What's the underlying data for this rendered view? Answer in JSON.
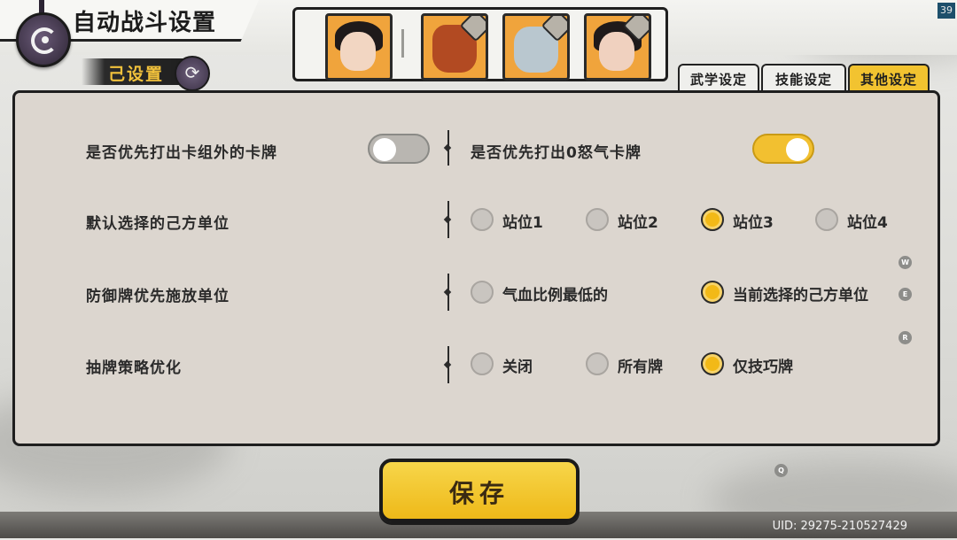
{
  "header": {
    "title": "自动战斗设置",
    "fps": "39"
  },
  "preset": {
    "label": "己设置"
  },
  "heroes": [
    {
      "name": "hero-1",
      "skin": "#f2d6c2",
      "bg": "#f0a43c"
    },
    {
      "name": "hero-2",
      "skin": "#b24a22",
      "bg": "#f0a43c"
    },
    {
      "name": "hero-3",
      "skin": "#b9c7cf",
      "bg": "#f0a43c"
    },
    {
      "name": "hero-4",
      "skin": "#f0d1bf",
      "bg": "#f0a43c"
    }
  ],
  "tabs": [
    {
      "label": "武学设定",
      "active": false
    },
    {
      "label": "技能设定",
      "active": false
    },
    {
      "label": "其他设定",
      "active": true
    }
  ],
  "settings": {
    "row1_left": {
      "label": "是否优先打出卡组外的卡牌",
      "on": false
    },
    "row1_right": {
      "label": "是否优先打出0怒气卡牌",
      "on": true
    },
    "row2": {
      "label": "默认选择的己方单位",
      "options": [
        "站位1",
        "站位2",
        "站位3",
        "站位4"
      ],
      "selected": 2
    },
    "row3": {
      "label": "防御牌优先施放单位",
      "options": [
        "气血比例最低的",
        "当前选择的己方单位"
      ],
      "selected": 1
    },
    "row4": {
      "label": "抽牌策略优化",
      "options": [
        "关闭",
        "所有牌",
        "仅技巧牌"
      ],
      "selected": 2
    }
  },
  "hotkeys": {
    "w": "W",
    "e": "E",
    "r": "R",
    "q": "Q"
  },
  "save": {
    "label": "保存"
  },
  "footer": {
    "uid": "UID: 29275-210527429"
  },
  "colors": {
    "accent": "#f2c330",
    "panel": "#dcd6cf"
  }
}
